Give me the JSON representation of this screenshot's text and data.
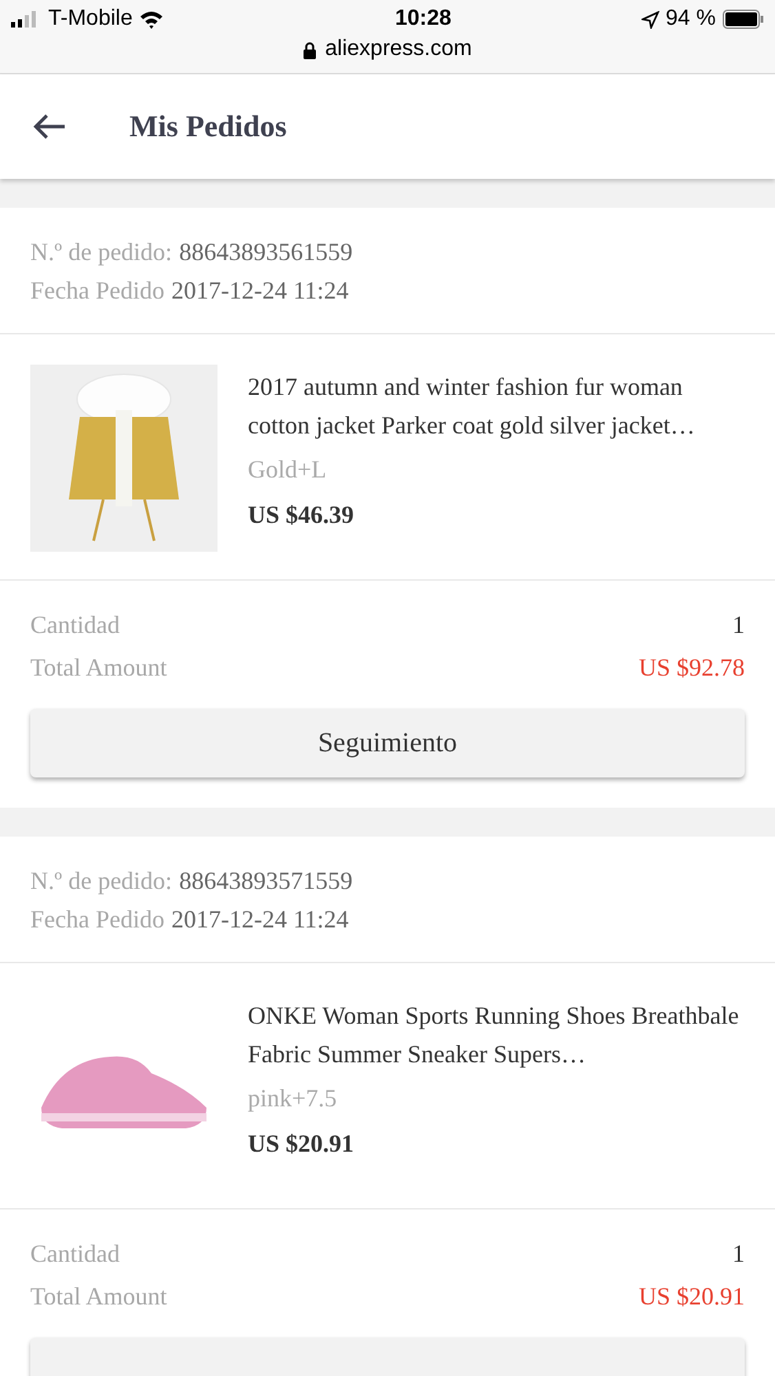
{
  "status_bar": {
    "carrier": "T-Mobile",
    "time": "10:28",
    "battery": "94 %",
    "url": "aliexpress.com"
  },
  "header": {
    "title": "Mis Pedidos"
  },
  "orders": [
    {
      "number_label": "N.º de pedido:",
      "number": "88643893561559",
      "date_label": "Fecha Pedido",
      "date": "2017-12-24 11:24",
      "product_title": "2017 autumn and winter fashion fur woman cotton jacket Parker coat gold silver jacket…",
      "variant": "Gold+L",
      "price": "US $46.39",
      "kind": "jacket",
      "quantity_label": "Cantidad",
      "quantity": "1",
      "total_label": "Total Amount",
      "total": "US $92.78",
      "button": "Seguimiento"
    },
    {
      "number_label": "N.º de pedido:",
      "number": "88643893571559",
      "date_label": "Fecha Pedido",
      "date": "2017-12-24 11:24",
      "product_title": "ONKE Woman Sports Running Shoes Breathbale Fabric Summer Sneaker Supers…",
      "variant": "pink+7.5",
      "price": "US $20.91",
      "kind": "shoe",
      "quantity_label": "Cantidad",
      "quantity": "1",
      "total_label": "Total Amount",
      "total": "US $20.91"
    }
  ]
}
